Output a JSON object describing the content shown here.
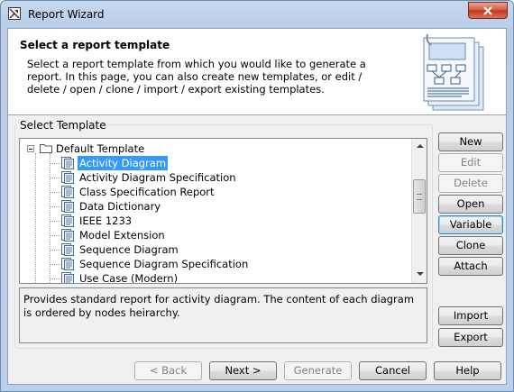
{
  "window": {
    "title": "Report Wizard"
  },
  "header": {
    "title": "Select a report template",
    "description": "Select a report template from which you would like to generate a report. In this page, you can also create new templates, or edit / delete / open / clone / import / export existing templates."
  },
  "group": {
    "label": "Select Template"
  },
  "tree": {
    "root": "Default Template",
    "items": [
      {
        "label": "Activity Diagram",
        "selected": true
      },
      {
        "label": "Activity Diagram Specification"
      },
      {
        "label": "Class Specification Report"
      },
      {
        "label": "Data Dictionary"
      },
      {
        "label": "IEEE 1233"
      },
      {
        "label": "Model Extension"
      },
      {
        "label": "Sequence Diagram"
      },
      {
        "label": "Sequence Diagram Specification"
      },
      {
        "label": "Use Case (Modern)"
      }
    ]
  },
  "description_text": "Provides standard report for activity diagram. The content of each diagram is ordered by nodes heirarchy.",
  "side_buttons": {
    "new": "New",
    "edit": "Edit",
    "delete": "Delete",
    "open": "Open",
    "variable": "Variable",
    "clone": "Clone",
    "attach": "Attach",
    "import": "Import",
    "export": "Export"
  },
  "footer_buttons": {
    "back": "< Back",
    "next": "Next >",
    "generate": "Generate",
    "cancel": "Cancel",
    "help": "Help"
  },
  "icons": {
    "app": "report-wizard-icon",
    "close": "close-icon",
    "folder": "folder-icon",
    "template": "report-template-icon",
    "header_image": "report-documents-icon"
  },
  "colors": {
    "selection": "#3399ff",
    "close_button": "#c1371a"
  }
}
